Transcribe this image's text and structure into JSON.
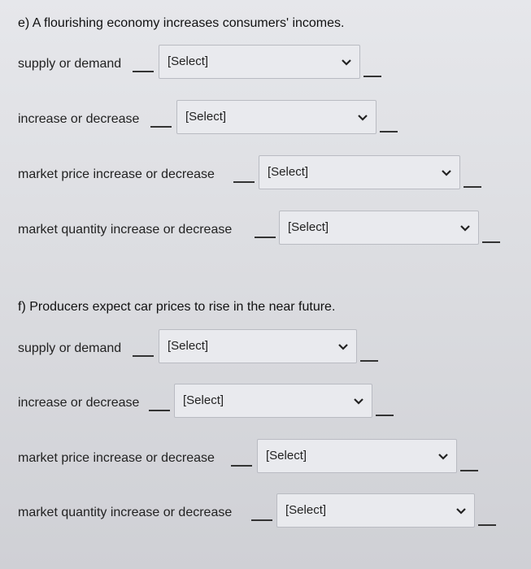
{
  "section_e": {
    "heading": "e) A flourishing economy increases consumers' incomes.",
    "rows": [
      {
        "label": "supply or demand",
        "select": "[Select]"
      },
      {
        "label": "increase or decrease",
        "select": "[Select]"
      },
      {
        "label": "market price increase or decrease",
        "select": "[Select]"
      },
      {
        "label": "market quantity increase or decrease",
        "select": "[Select]"
      }
    ]
  },
  "section_f": {
    "heading": "f) Producers expect car prices to rise in the near future.",
    "rows": [
      {
        "label": "supply or demand",
        "select": "[Select]"
      },
      {
        "label": "increase or decrease",
        "select": "[Select]"
      },
      {
        "label": "market price increase or decrease",
        "select": "[Select]"
      },
      {
        "label": "market quantity increase or decrease",
        "select": "[Select]"
      }
    ]
  },
  "icons": {
    "dropdown": "chevron-down-icon"
  }
}
